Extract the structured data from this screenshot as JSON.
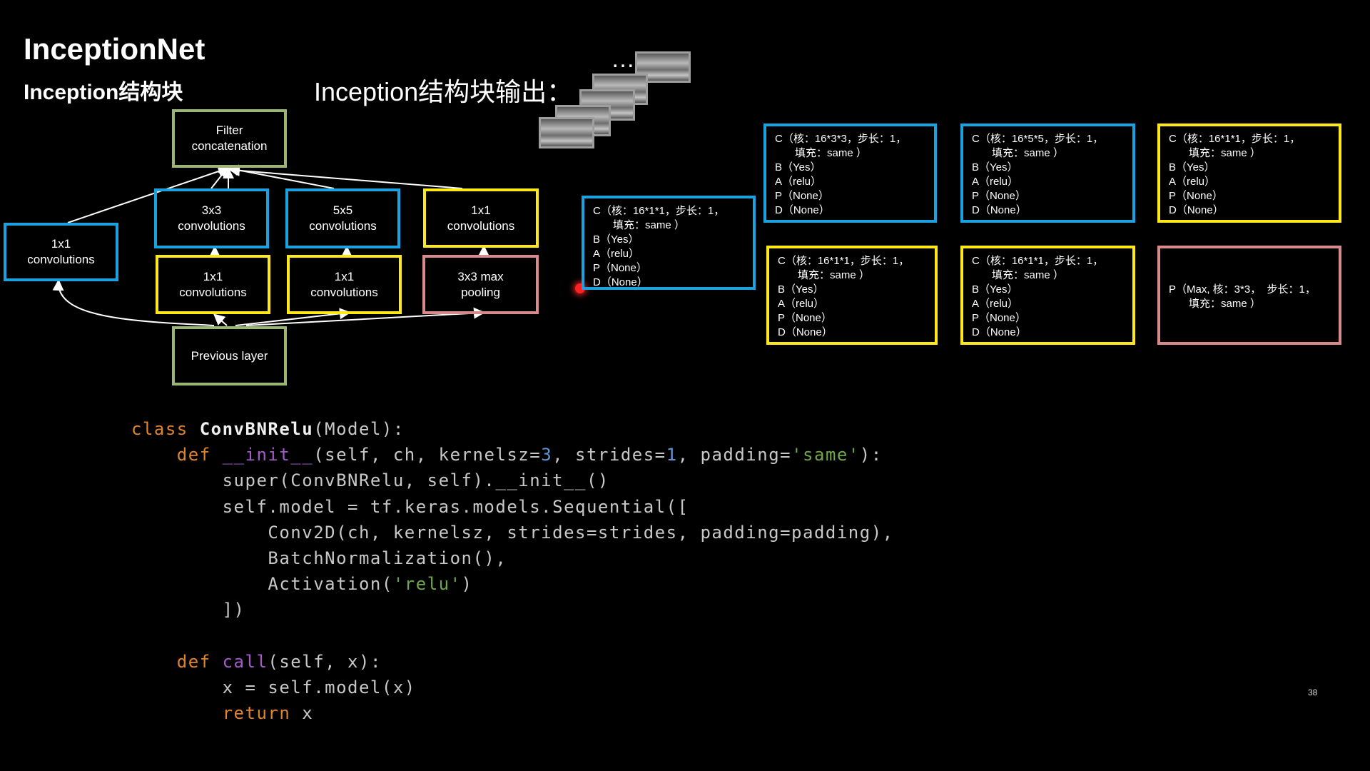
{
  "slide": {
    "title": "InceptionNet",
    "subtitle": "Inception结构块",
    "output_title": "Inception结构块输出：",
    "ellipsis": "…",
    "page_number": "38"
  },
  "diagram": {
    "filter_concat": "Filter\nconcatenation",
    "conv1x1_left": "1x1\nconvolutions",
    "conv3x3": "3x3\nconvolutions",
    "conv5x5": "5x5\nconvolutions",
    "conv1x1_top_right": "1x1\nconvolutions",
    "conv1x1_a": "1x1\nconvolutions",
    "conv1x1_b": "1x1\nconvolutions",
    "maxpool": "3x3 max\npooling",
    "previous_layer": "Previous layer"
  },
  "configs": {
    "branch1": [
      "C（核：16*1*1，步长：1，",
      "填充：same ）",
      "B（Yes）",
      "A（relu）",
      "P（None）",
      "D（None）"
    ],
    "branch2_top": [
      "C（核：16*3*3，步长：1，",
      "填充：same ）",
      "B（Yes）",
      "A（relu）",
      "P（None）",
      "D（None）"
    ],
    "branch3_top": [
      "C（核：16*5*5，步长：1，",
      "填充：same ）",
      "B（Yes）",
      "A（relu）",
      "P（None）",
      "D（None）"
    ],
    "branch4_top": [
      "C（核：16*1*1，步长：1，",
      "填充：same ）",
      "B（Yes）",
      "A（relu）",
      "P（None）",
      "D（None）"
    ],
    "branch2_bottom": [
      "C（核：16*1*1，步长：1，",
      "填充：same ）",
      "B（Yes）",
      "A（relu）",
      "P（None）",
      "D（None）"
    ],
    "branch3_bottom": [
      "C（核：16*1*1，步长：1，",
      "填充：same ）",
      "B（Yes）",
      "A（relu）",
      "P（None）",
      "D（None）"
    ],
    "branch4_bottom": [
      "P（Max, 核：3*3，  步长：1，",
      "填充：same ）"
    ]
  },
  "code": {
    "l1": [
      "class",
      "ConvBNRelu",
      "(Model):"
    ],
    "l2": [
      "def",
      "__init__",
      "(self, ch, kernelsz=",
      "3",
      ", strides=",
      "1",
      ", padding=",
      "'same'",
      "):"
    ],
    "l3": "super(ConvBNRelu, self).__init__()",
    "l4": "self.model = tf.keras.models.Sequential([",
    "l5": "Conv2D(ch, kernelsz, strides=strides, padding=padding),",
    "l6": "BatchNormalization(),",
    "l7": [
      "Activation(",
      "'relu'",
      ")"
    ],
    "l8": "])",
    "l10": [
      "def",
      "call",
      "(self, x):"
    ],
    "l11": "x = self.model(x)",
    "l12": [
      "return",
      "x"
    ]
  },
  "colors": {
    "blue_border": "#1aa1e0",
    "yellow_border": "#ffe81a",
    "green_border": "#9bb573",
    "pink_border": "#d7898c",
    "keyword": "#e1832b",
    "function": "#a45bc9",
    "number": "#5f95d5",
    "string": "#6fa84a"
  }
}
